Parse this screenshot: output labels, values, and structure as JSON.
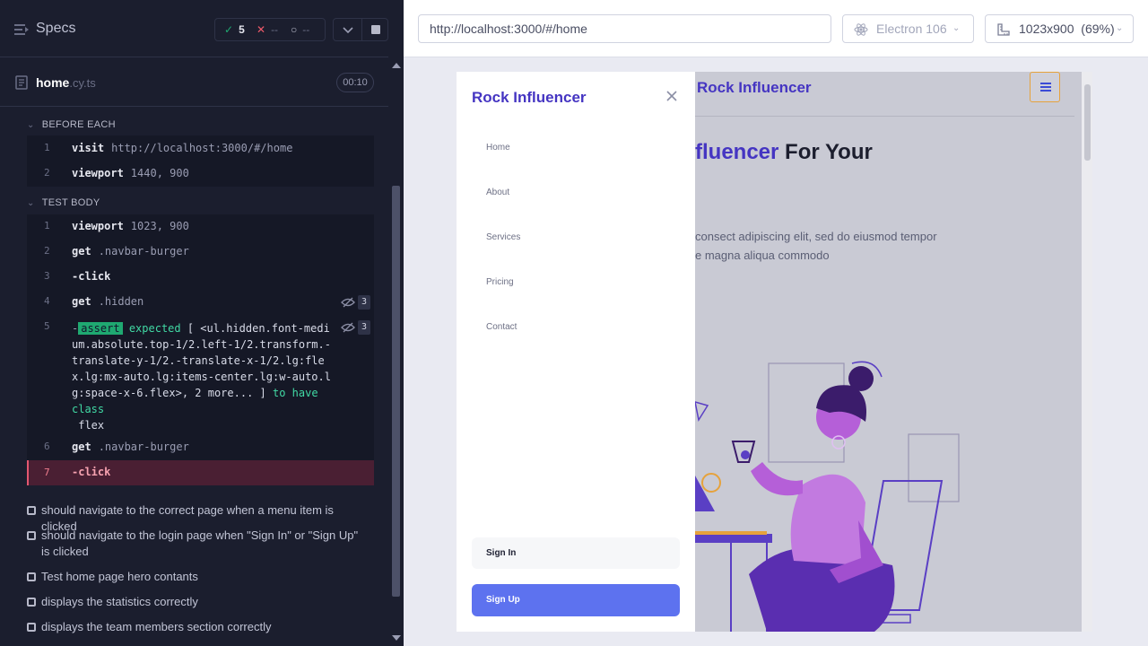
{
  "reporter": {
    "specs_title": "Specs",
    "stats": {
      "passed": "5",
      "failed": "--",
      "pending": "--"
    },
    "spec": {
      "name": "home",
      "ext": ".cy.ts",
      "duration": "00:10"
    },
    "before_each": {
      "heading": "BEFORE EACH",
      "commands": [
        {
          "num": "1",
          "name": "visit",
          "arg": "http://localhost:3000/#/home"
        },
        {
          "num": "2",
          "name": "viewport",
          "arg": "1440, 900"
        }
      ]
    },
    "test_body": {
      "heading": "TEST BODY",
      "commands": [
        {
          "num": "1",
          "name": "viewport",
          "arg": "1023, 900"
        },
        {
          "num": "2",
          "name": "get",
          "arg": ".navbar-burger"
        },
        {
          "num": "3",
          "name": "-click",
          "arg": ""
        },
        {
          "num": "4",
          "name": "get",
          "arg": ".hidden",
          "count": "3"
        },
        {
          "num": "6",
          "name": "get",
          "arg": ".navbar-burger"
        },
        {
          "num": "7",
          "name": "-click",
          "arg": ""
        }
      ],
      "assert": {
        "num": "5",
        "count": "3",
        "dash": "-",
        "pill": "assert",
        "expected": "expected",
        "object": "[ <ul.hidden.font-medium.absolute.top-1/2.left-1/2.transform.-translate-y-1/2.-translate-x-1/2.lg:flex.lg:mx-auto.lg:items-center.lg:w-auto.lg:space-x-6.flex>, 2 more... ]",
        "to_have": "to have class",
        "class_name": "flex"
      }
    },
    "tests": [
      "should navigate to the correct page when a menu item is clicked",
      "should navigate to the login page when \"Sign In\" or \"Sign Up\" is clicked",
      "Test home page hero contants",
      "displays the statistics correctly",
      "displays the team members section correctly"
    ]
  },
  "aut": {
    "url": "http://localhost:3000/#/home",
    "browser": "Electron 106",
    "viewport": "1023x900",
    "scale": "(69%)",
    "site": {
      "logo": "Rock Influencer",
      "hero_title_accent": "fluencer",
      "hero_title_rest": " For Your",
      "hero_line1": "consect adipiscing elit, sed do eiusmod tempor",
      "hero_line2": "e magna aliqua commodo"
    },
    "drawer": {
      "logo": "Rock Influencer",
      "nav": [
        "Home",
        "About",
        "Services",
        "Pricing",
        "Contact"
      ],
      "sign_in": "Sign In",
      "sign_up": "Sign Up"
    }
  }
}
